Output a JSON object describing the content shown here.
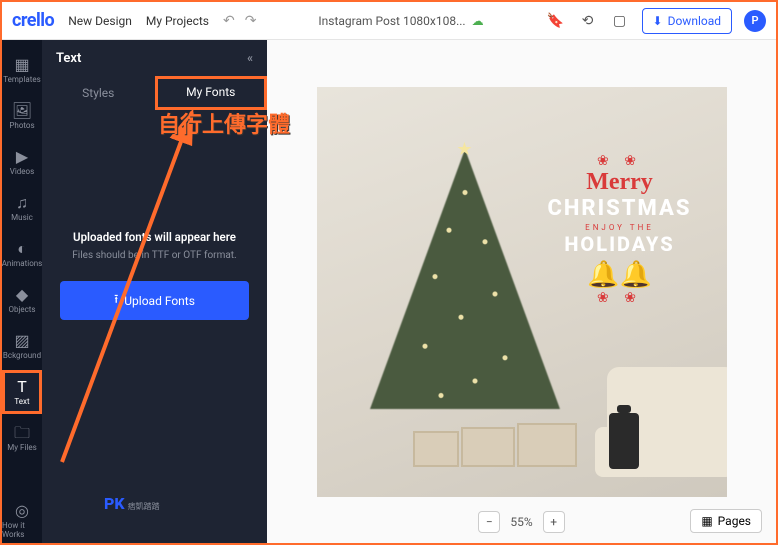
{
  "topbar": {
    "logo": "crello",
    "new_design": "New Design",
    "my_projects": "My Projects",
    "doc_title": "Instagram Post 1080x108...",
    "download": "Download",
    "avatar_letter": "P"
  },
  "rail": {
    "templates": "Templates",
    "photos": "Photos",
    "videos": "Videos",
    "music": "Music",
    "animations": "Animations",
    "objects": "Objects",
    "background": "Bckground",
    "text": "Text",
    "my_files": "My Files",
    "how_it_works": "How it Works"
  },
  "panel": {
    "title": "Text",
    "tab_styles": "Styles",
    "tab_my_fonts": "My Fonts",
    "upload_title": "Uploaded fonts will appear here",
    "upload_sub": "Files should be in TTF or OTF format.",
    "upload_btn": "Upload Fonts"
  },
  "canvas_art": {
    "merry": "Merry",
    "christmas": "CHRISTMAS",
    "enjoy": "ENJOY THE",
    "holidays": "HOLIDAYS"
  },
  "bottom": {
    "zoom": "55%",
    "pages": "Pages"
  },
  "annotation": {
    "text": "自行上傳字體"
  },
  "watermark": {
    "pk": "PK",
    "sub": "痞凱踏踏"
  }
}
